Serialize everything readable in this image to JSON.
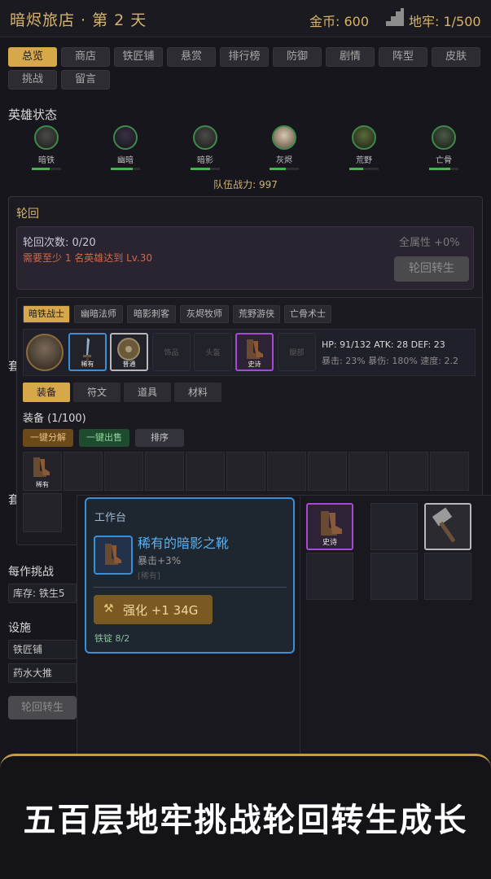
{
  "header": {
    "title": "暗烬旅店 · 第 2 天",
    "gold": "金币: 600",
    "dungeon": "地牢: 1/500"
  },
  "tabs": [
    "总览",
    "商店",
    "铁匠铺",
    "悬赏",
    "排行榜",
    "防御",
    "剧情",
    "阵型",
    "皮肤",
    "挑战",
    "留言"
  ],
  "heroes": {
    "section_label": "英雄状态",
    "list": [
      {
        "name": "暗铁",
        "hp": 0.62
      },
      {
        "name": "幽暗",
        "hp": 0.75
      },
      {
        "name": "暗影",
        "hp": 0.68
      },
      {
        "name": "灰烬",
        "hp": 0.55
      },
      {
        "name": "荒野",
        "hp": 0.48
      },
      {
        "name": "亡骨",
        "hp": 0.72
      }
    ],
    "team_power": "队伍战力: 997"
  },
  "reincarnation": {
    "title": "轮回",
    "count": "轮回次数: 0/20",
    "requirement": "需要至少 1 名英雄达到 Lv.30",
    "bonus": "全属性 +0%",
    "button": "轮回转生"
  },
  "hero_detail": {
    "tabs": [
      "暗铁战士",
      "幽暗法师",
      "暗影刺客",
      "灰烬牧师",
      "荒野游侠",
      "亡骨术士"
    ],
    "slots": [
      {
        "name": "weapon",
        "tag": "稀有",
        "rarity": "blue"
      },
      {
        "name": "shield",
        "tag": "普通",
        "rarity": "white"
      },
      {
        "name": "accessory",
        "tag": "饰品",
        "rarity": "empty"
      },
      {
        "name": "helmet",
        "tag": "头盔",
        "rarity": "empty"
      },
      {
        "name": "boots",
        "tag": "史诗",
        "rarity": "purple"
      },
      {
        "name": "armor",
        "tag": "腿部",
        "rarity": "empty"
      }
    ],
    "stats_line1": "HP: 91/132  ATK: 28  DEF: 23",
    "stats_line2": "暴击: 23%  暴伤: 180%  速度: 2.2"
  },
  "inventory": {
    "tabs": [
      "装备",
      "符文",
      "道具",
      "材料"
    ],
    "title": "装备 (1/100)",
    "actions": [
      "一键分解",
      "一键出售",
      "排序"
    ],
    "first_item_tag": "稀有"
  },
  "workbench": {
    "title": "工作台",
    "item_name": "稀有的暗影之靴",
    "item_stat": "暴击+3%",
    "item_rarity": "[稀有]",
    "upgrade_button": "强化 +1  34G",
    "material": "铁锭 8/2"
  },
  "side_items": [
    {
      "tag": "史诗",
      "rarity": "purple"
    },
    {
      "tag": "",
      "rarity": "empty"
    },
    {
      "tag": "",
      "rarity": "white"
    }
  ],
  "left_sections": {
    "daily": "每作挑战",
    "stock": "库存: 铁生5",
    "facilities": "设施",
    "facility_rows": [
      "铁匠铺",
      "药水大推"
    ],
    "reinc_btn": "轮回转生",
    "partial_1": "套",
    "partial_2": "套"
  },
  "banner": {
    "text": "五百层地牢挑战轮回转生成长"
  },
  "colors": {
    "accent": "#d7a84a",
    "rare": "#3a8fd6",
    "epic": "#a64ad6",
    "hp": "#4caf50"
  }
}
